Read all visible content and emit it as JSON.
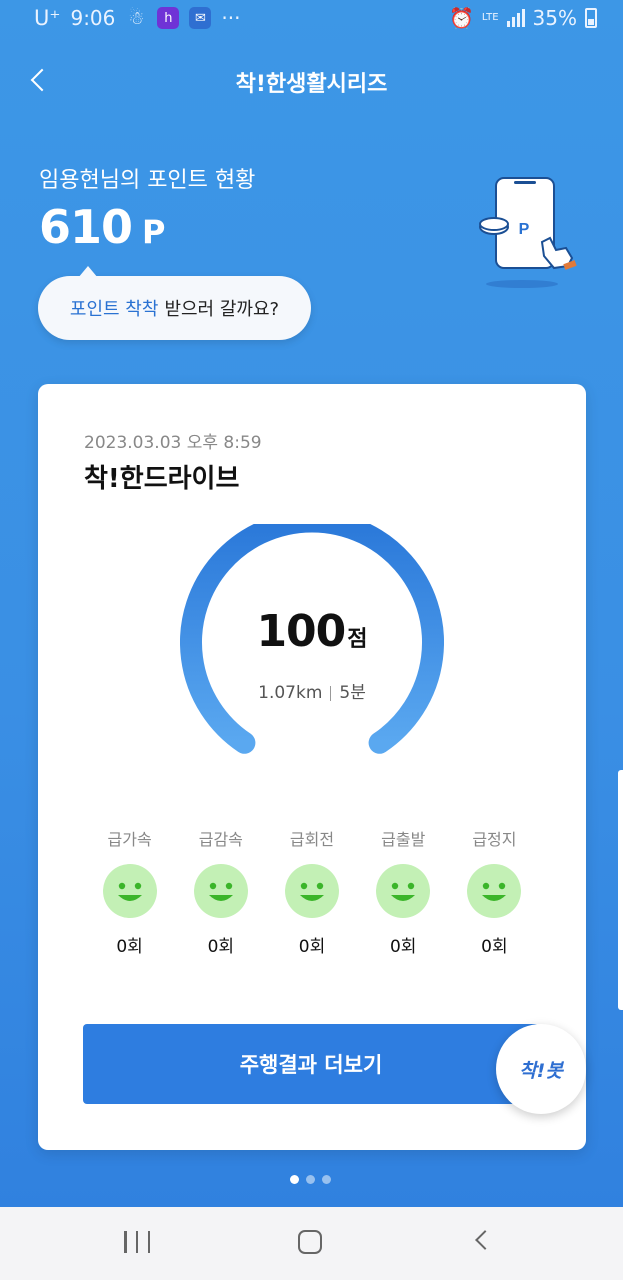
{
  "status_bar": {
    "carrier": "U⁺",
    "time": "9:06",
    "more": "···",
    "network": "LTE",
    "battery": "35%"
  },
  "header": {
    "title": "착!한생활시리즈"
  },
  "points": {
    "heading": "임용현님의 포인트 현황",
    "value": "610",
    "unit": "P"
  },
  "illustration": {
    "phone_label": "P"
  },
  "bubble": {
    "highlight": "포인트 착착",
    "text": "받으러 갈까요?"
  },
  "card": {
    "date": "2023.03.03 오후 8:59",
    "title": "착!한드라이브",
    "score": {
      "value": "100",
      "unit": "점",
      "distance": "1.07km",
      "duration": "5분",
      "gauge_fraction": 1.0
    },
    "events": [
      {
        "label": "급가속",
        "count": "0회"
      },
      {
        "label": "급감속",
        "count": "0회"
      },
      {
        "label": "급회전",
        "count": "0회"
      },
      {
        "label": "급출발",
        "count": "0회"
      },
      {
        "label": "급정지",
        "count": "0회"
      }
    ],
    "more_button": "주행결과 더보기"
  },
  "chatbot": {
    "label": "착!봇"
  },
  "pager": {
    "count": 3,
    "active": 1
  },
  "colors": {
    "accent": "#2e7de0",
    "smile_bg": "#c3f0b5",
    "smile_fg": "#3bb52a"
  }
}
